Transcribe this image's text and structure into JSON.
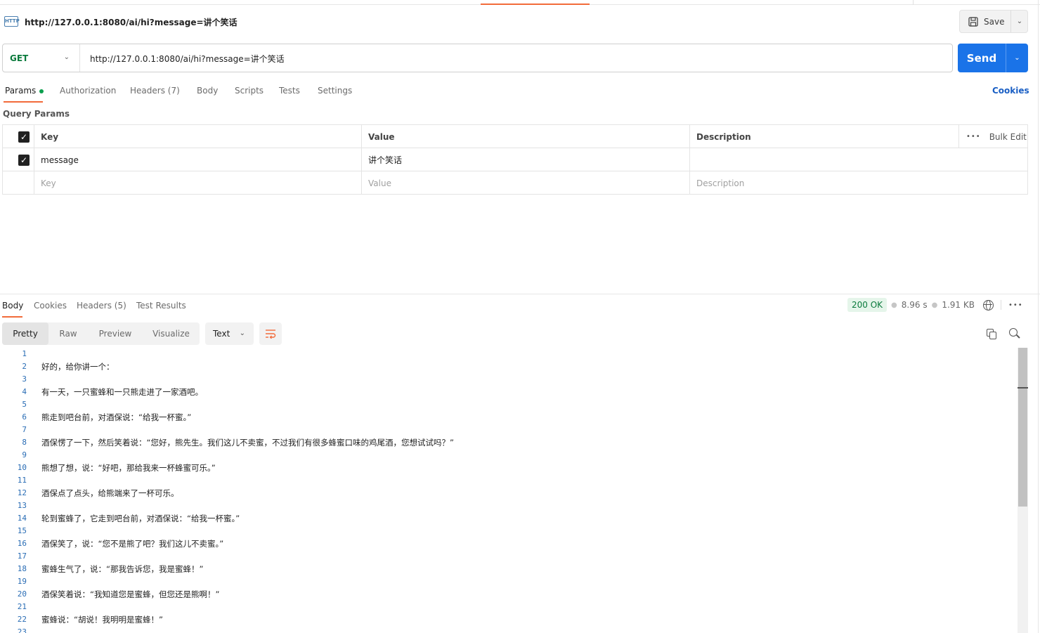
{
  "request": {
    "title": "http://127.0.0.1:8080/ai/hi?message=讲个笑话",
    "method": "GET",
    "url": "http://127.0.0.1:8080/ai/hi?message=讲个笑话",
    "http_icon_text": "HTTP",
    "save_label": "Save",
    "send_label": "Send"
  },
  "request_tabs": {
    "params": "Params",
    "authorization": "Authorization",
    "headers": "Headers (7)",
    "body": "Body",
    "scripts": "Scripts",
    "tests": "Tests",
    "settings": "Settings",
    "cookies": "Cookies"
  },
  "query_params": {
    "label": "Query Params",
    "headers": {
      "key": "Key",
      "value": "Value",
      "description": "Description",
      "bulk_edit": "Bulk Edit"
    },
    "rows": [
      {
        "checked": true,
        "key": "message",
        "value": "讲个笑话",
        "description": ""
      }
    ],
    "placeholder": {
      "key": "Key",
      "value": "Value",
      "description": "Description"
    }
  },
  "response": {
    "tabs": {
      "body": "Body",
      "cookies": "Cookies",
      "headers": "Headers (5)",
      "test_results": "Test Results"
    },
    "status": "200 OK",
    "time": "8.96 s",
    "size": "1.91 KB",
    "views": {
      "pretty": "Pretty",
      "raw": "Raw",
      "preview": "Preview",
      "visualize": "Visualize"
    },
    "format": "Text",
    "lines": [
      {
        "n": "1",
        "text": ""
      },
      {
        "n": "2",
        "text": "好的，给你讲一个："
      },
      {
        "n": "3",
        "text": ""
      },
      {
        "n": "4",
        "text": "有一天，一只蜜蜂和一只熊走进了一家酒吧。"
      },
      {
        "n": "5",
        "text": ""
      },
      {
        "n": "6",
        "text": "熊走到吧台前，对酒保说：“给我一杯蜜。”"
      },
      {
        "n": "7",
        "text": ""
      },
      {
        "n": "8",
        "text": "酒保愣了一下，然后笑着说：“您好，熊先生。我们这儿不卖蜜，不过我们有很多蜂蜜口味的鸡尾酒，您想试试吗？”"
      },
      {
        "n": "9",
        "text": ""
      },
      {
        "n": "10",
        "text": "熊想了想，说：“好吧，那给我来一杯蜂蜜可乐。”"
      },
      {
        "n": "11",
        "text": ""
      },
      {
        "n": "12",
        "text": "酒保点了点头，给熊端来了一杯可乐。"
      },
      {
        "n": "13",
        "text": ""
      },
      {
        "n": "14",
        "text": "轮到蜜蜂了，它走到吧台前，对酒保说：“给我一杯蜜。”"
      },
      {
        "n": "15",
        "text": ""
      },
      {
        "n": "16",
        "text": "酒保笑了，说：“您不是熊了吧？我们这儿不卖蜜。”"
      },
      {
        "n": "17",
        "text": ""
      },
      {
        "n": "18",
        "text": "蜜蜂生气了，说：“那我告诉您，我是蜜蜂！”"
      },
      {
        "n": "19",
        "text": ""
      },
      {
        "n": "20",
        "text": "酒保笑着说：“我知道您是蜜蜂，但您还是熊啊！”"
      },
      {
        "n": "21",
        "text": ""
      },
      {
        "n": "22",
        "text": "蜜蜂说：“胡说！我明明是蜜蜂！”"
      },
      {
        "n": "23",
        "text": ""
      }
    ]
  },
  "colors": {
    "accent": "#f26b3a",
    "send": "#1a73e8",
    "method_get": "#0a7a3c",
    "status_ok": "#0a7a3c",
    "line_number": "#2a6db5"
  }
}
